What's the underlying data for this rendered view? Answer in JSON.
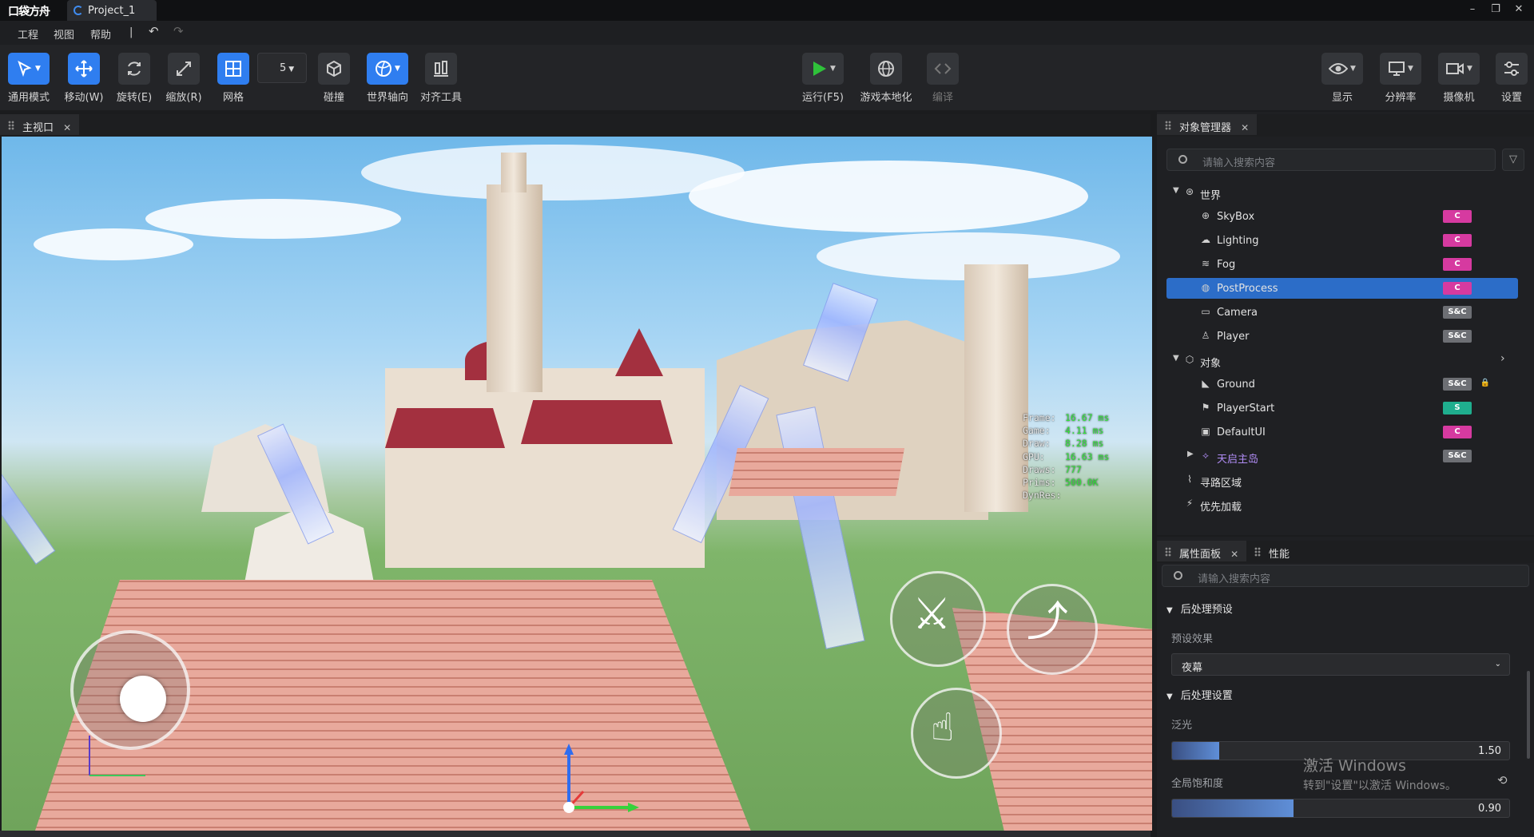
{
  "titlebar": {
    "logo": "口袋方舟",
    "tab_label": "Project_1",
    "min": "–",
    "max": "❐",
    "close": "✕"
  },
  "menu": {
    "items": [
      "工程",
      "视图",
      "帮助",
      "|"
    ],
    "undo": "↶",
    "redo": "↷"
  },
  "toolbar": {
    "left_tools": [
      {
        "label": "通用模式",
        "icon": "cursor-icon",
        "active": true
      },
      {
        "label": "移动(W)",
        "icon": "move-icon",
        "active": true
      },
      {
        "label": "旋转(E)",
        "icon": "rotate-icon",
        "active": false
      },
      {
        "label": "缩放(R)",
        "icon": "scale-icon",
        "active": false
      },
      {
        "label": "网格",
        "icon": "grid-icon",
        "active": true
      }
    ],
    "grid_size": "5",
    "mid_tools": [
      {
        "label": "碰撞",
        "icon": "collision-icon"
      },
      {
        "label": "世界轴向",
        "icon": "world-axis-icon"
      },
      {
        "label": "对齐工具",
        "icon": "align-icon"
      }
    ],
    "center_tools": [
      {
        "label": "运行(F5)",
        "icon": "play-icon"
      },
      {
        "label": "游戏本地化",
        "icon": "globe-icon"
      },
      {
        "label": "编译",
        "icon": "code-icon"
      }
    ],
    "right_tools": [
      {
        "label": "显示",
        "icon": "eye-icon"
      },
      {
        "label": "分辨率",
        "icon": "monitor-icon"
      },
      {
        "label": "摄像机",
        "icon": "camera-icon"
      },
      {
        "label": "设置",
        "icon": "settings-icon"
      }
    ]
  },
  "viewport": {
    "tab_label": "主视口",
    "stats": [
      {
        "k": "Frame:",
        "v": "16.67 ms"
      },
      {
        "k": "Game:",
        "v": "4.11 ms"
      },
      {
        "k": "Draw:",
        "v": "8.28 ms"
      },
      {
        "k": "GPU:",
        "v": "16.63 ms"
      },
      {
        "k": "Draws:",
        "v": "777"
      },
      {
        "k": "Prims:",
        "v": "500.0K"
      },
      {
        "k": "DynRes:",
        "v": ""
      }
    ]
  },
  "object_manager": {
    "tab_label": "对象管理器",
    "search_placeholder": "请输入搜索内容",
    "tree": [
      {
        "label": "世界",
        "level": 0,
        "expanded": true,
        "icon": "world-icon"
      },
      {
        "label": "SkyBox",
        "level": 1,
        "badge": "C",
        "icon": "skybox-icon"
      },
      {
        "label": "Lighting",
        "level": 1,
        "badge": "C",
        "icon": "cloud-icon"
      },
      {
        "label": "Fog",
        "level": 1,
        "badge": "C",
        "icon": "fog-icon"
      },
      {
        "label": "PostProcess",
        "level": 1,
        "badge": "C",
        "icon": "postprocess-icon",
        "selected": true
      },
      {
        "label": "Camera",
        "level": 1,
        "badge": "S&C",
        "icon": "camera-icon"
      },
      {
        "label": "Player",
        "level": 1,
        "badge": "S&C",
        "icon": "player-icon"
      },
      {
        "label": "对象",
        "level": 0,
        "expanded": true,
        "icon": "cube-icon"
      },
      {
        "label": "Ground",
        "level": 1,
        "badge": "S&C",
        "icon": "ground-icon",
        "locked": true
      },
      {
        "label": "PlayerStart",
        "level": 1,
        "badge": "S",
        "icon": "flag-icon"
      },
      {
        "label": "DefaultUI",
        "level": 1,
        "badge": "C",
        "icon": "ui-icon"
      },
      {
        "label": "天启主岛",
        "level": 1,
        "badge": "S&C",
        "icon": "prefab-icon",
        "collapsed": true,
        "purple": true
      },
      {
        "label": "寻路区域",
        "level": 0,
        "icon": "navmesh-icon"
      },
      {
        "label": "优先加载",
        "level": 0,
        "icon": "priority-icon"
      }
    ]
  },
  "properties": {
    "tab_label": "属性面板",
    "tab2_label": "性能",
    "search_placeholder": "请输入搜索内容",
    "section1": "后处理预设",
    "preset_label": "预设效果",
    "preset_value": "夜幕",
    "section2": "后处理设置",
    "bloom_label": "泛光",
    "bloom_value": "1.50",
    "bloom_fraction": 0.14,
    "saturation_label": "全局饱和度",
    "saturation_value": "0.90",
    "saturation_fraction": 0.36
  },
  "watermark": {
    "line1": "激活 Windows",
    "line2": "转到\"设置\"以激活 Windows。"
  }
}
